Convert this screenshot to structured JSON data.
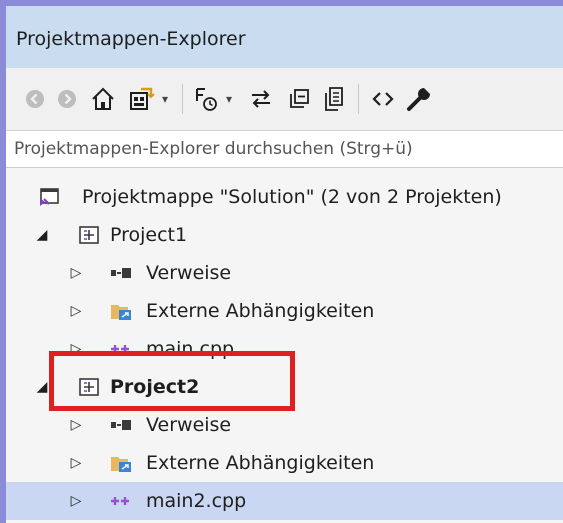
{
  "window": {
    "title": "Projektmappen-Explorer"
  },
  "search": {
    "placeholder": "Projektmappen-Explorer durchsuchen (Strg+ü)"
  },
  "tree": {
    "solution": {
      "label": "Projektmappe \"Solution\" (2 von 2 Projekten)"
    },
    "project1": {
      "label": "Project1",
      "children": [
        {
          "label": "Verweise"
        },
        {
          "label": "Externe Abhängigkeiten"
        },
        {
          "label": "main.cpp"
        }
      ]
    },
    "project2": {
      "label": "Project2",
      "children": [
        {
          "label": "Verweise"
        },
        {
          "label": "Externe Abhängigkeiten"
        },
        {
          "label": "main2.cpp"
        }
      ]
    }
  },
  "toolbar": {
    "icons": [
      "back-icon",
      "forward-icon",
      "home-icon",
      "switch-views-icon",
      "pending-changes-icon",
      "sync-icon",
      "collapse-all-icon",
      "show-all-files-icon",
      "code-icon",
      "properties-icon"
    ]
  },
  "colors": {
    "titlebar": "#c9dcf0",
    "selected_row": "#c9d7f2",
    "highlight_box": "#e02020",
    "accent": "#8b8bd8"
  }
}
